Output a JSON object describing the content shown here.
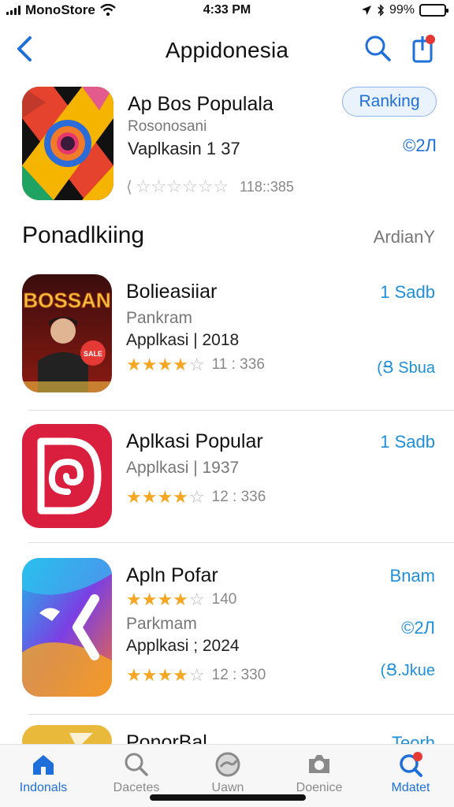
{
  "status_bar": {
    "carrier": "MonoStore",
    "time": "4:33 PM",
    "battery": "99%"
  },
  "nav": {
    "title": "Appidonesia"
  },
  "featured": {
    "name": "Ap Bos Populala",
    "subtitle": "Rosonosani",
    "category": "Vaplkasin 1 37",
    "rating_count": "118::385",
    "ranking_button": "Ranking",
    "version": "©2Л"
  },
  "section": {
    "title": "Ponadlkiing",
    "more": "ArdianY"
  },
  "apps": [
    {
      "name": "Bolieasiiar",
      "developer": "Pankram",
      "category": "Applkasi | 2018",
      "rating_count": "11 : 336",
      "action": "1 Sadb",
      "action_secondary": "(Ց Sbua",
      "icon_text": "BOSSAN",
      "rating": 4
    },
    {
      "name": "Aplkasi Popular",
      "developer": "",
      "category": "Applkasi | 1937",
      "rating_count": "12 : 336",
      "action": "1 Sadb",
      "action_secondary": "",
      "icon_text": "",
      "rating": 4
    },
    {
      "name": "Apln Pofar",
      "developer": "Parkmam",
      "category": "Applkasi ; 2024",
      "rating_top_count": "140",
      "rating_count": "12 : 330",
      "action": "Bnam",
      "action_mid": "©2Л",
      "action_secondary": "(Ց.Jkue",
      "icon_text": "",
      "rating": 4
    },
    {
      "name": "PonorBal",
      "action": "Teorh"
    }
  ],
  "tabs": [
    {
      "label": "Indonals",
      "icon": "house-icon",
      "active": true
    },
    {
      "label": "Dacetes",
      "icon": "search-icon",
      "active": false
    },
    {
      "label": "Uawn",
      "icon": "globe-icon",
      "active": false
    },
    {
      "label": "Doenice",
      "icon": "camera-icon",
      "active": false
    },
    {
      "label": "Mdatet",
      "icon": "search-badge-icon",
      "active": true
    }
  ],
  "colors": {
    "accent": "#1e6fd9",
    "star": "#f5a623",
    "badge": "#e53935"
  }
}
